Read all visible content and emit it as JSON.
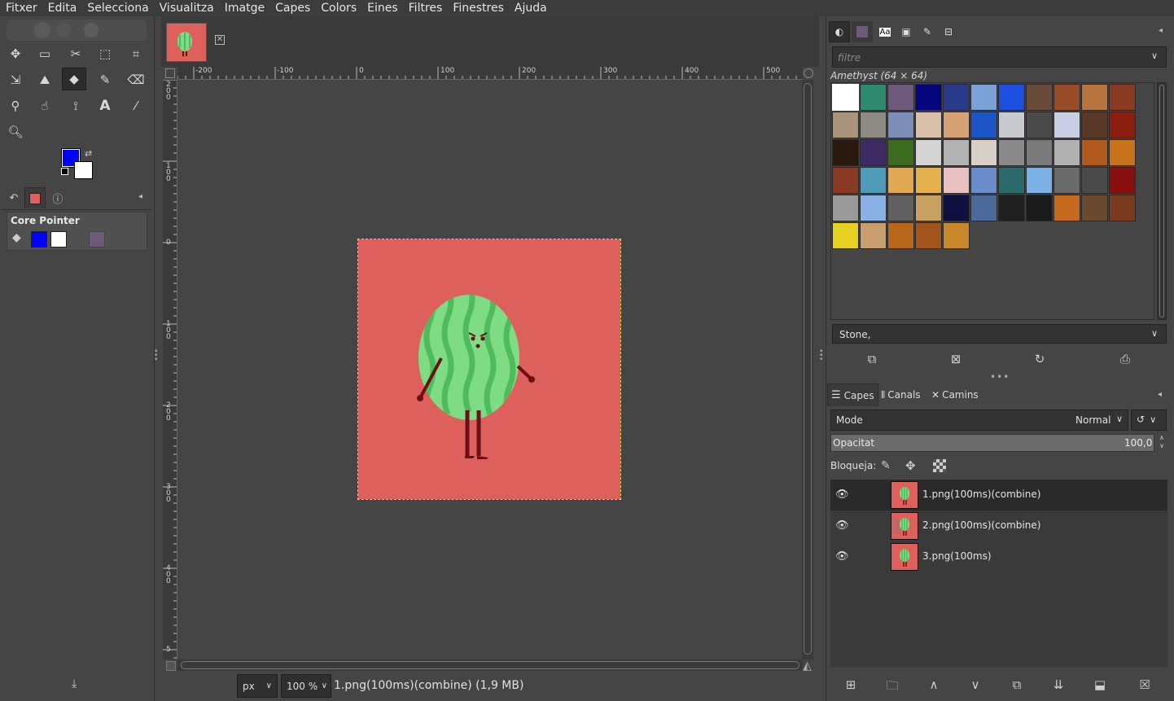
{
  "menu": [
    "Fitxer",
    "Edita",
    "Selecciona",
    "Visualitza",
    "Imatge",
    "Capes",
    "Colors",
    "Eines",
    "Filtres",
    "Finestres",
    "Ajuda"
  ],
  "colors": {
    "foreground": "#0000ff",
    "background": "#ffffff",
    "image_bg": "#de605c",
    "melon_light": "#7edc84",
    "melon_dark": "#4ebb5c",
    "limb": "#6b1016"
  },
  "tool_options": {
    "title": "Core Pointer"
  },
  "rulers": {
    "h_labels": [
      "-200",
      "-100",
      "0",
      "100",
      "200",
      "300",
      "400",
      "500"
    ],
    "v_labels": [
      "2\n0\n0",
      "1\n0\n0",
      "0",
      "1\n0\n0",
      "2\n0\n0",
      "3\n0\n0",
      "4\n0\n0",
      "5"
    ]
  },
  "status": {
    "unit": "px",
    "zoom": "100 %",
    "info": "1.png(100ms)(combine) (1,9 MB)"
  },
  "patterns": {
    "filter_placeholder": "filtre",
    "title": "Amethyst (64 × 64)",
    "selected_name": "Stone,",
    "swatches": [
      "#ffffff",
      "#2e8a6e",
      "#6d5a7a",
      "#05057e",
      "#2a3b8c",
      "#7aa2d6",
      "#1d4fe0",
      "#6a4b3a",
      "#9a4c28",
      "#b8743e",
      "#8a3a22",
      "#a89478",
      "#8e8a86",
      "#7d8fb8",
      "#d9c0a8",
      "#d7a176",
      "#1e55c6",
      "#c8c8d0",
      "#4a4a4a",
      "#c9cfe2",
      "#5a3828",
      "#8c1e10",
      "#2a1a0e",
      "#3d2a62",
      "#3c6a1e",
      "#d4d4d4",
      "#b2b2b2",
      "#d8d0c8",
      "#8a8a8a",
      "#7a7a7a",
      "#b0b0b0",
      "#b25a1e",
      "#c8721e",
      "#8a3a22",
      "#4e9ab8",
      "#e0a850",
      "#e6b04e",
      "#e8c0c0",
      "#6a8ccc",
      "#2a6a6a",
      "#7ab2e8",
      "#6a6a6a",
      "#4a4a4a",
      "#8a1010",
      "#9a9a9a",
      "#8ab2e6",
      "#606060",
      "#c8a060",
      "#101040",
      "#4a6a9a",
      "#202020",
      "#1a1a1a",
      "#c86a1e",
      "#6a4a2e",
      "#7a3a1e",
      "#e8d020",
      "#c89e6e",
      "#b8661a",
      "#a2541a",
      "#c8882a"
    ]
  },
  "pattern_buttons": [
    "new-pattern-icon",
    "delete-pattern-icon",
    "refresh-icon",
    "open-as-image-icon"
  ],
  "layers_tabs": [
    "Capes",
    "Canals",
    "Camins"
  ],
  "layers": {
    "mode_label": "Mode",
    "mode_value": "Normal",
    "opacity_label": "Opacitat",
    "opacity_value": "100,0",
    "lock_label": "Bloqueja:",
    "items": [
      {
        "name": "1.png(100ms)(combine)",
        "selected": true
      },
      {
        "name": "2.png(100ms)(combine)",
        "selected": false
      },
      {
        "name": "3.png(100ms)",
        "selected": false
      }
    ]
  }
}
